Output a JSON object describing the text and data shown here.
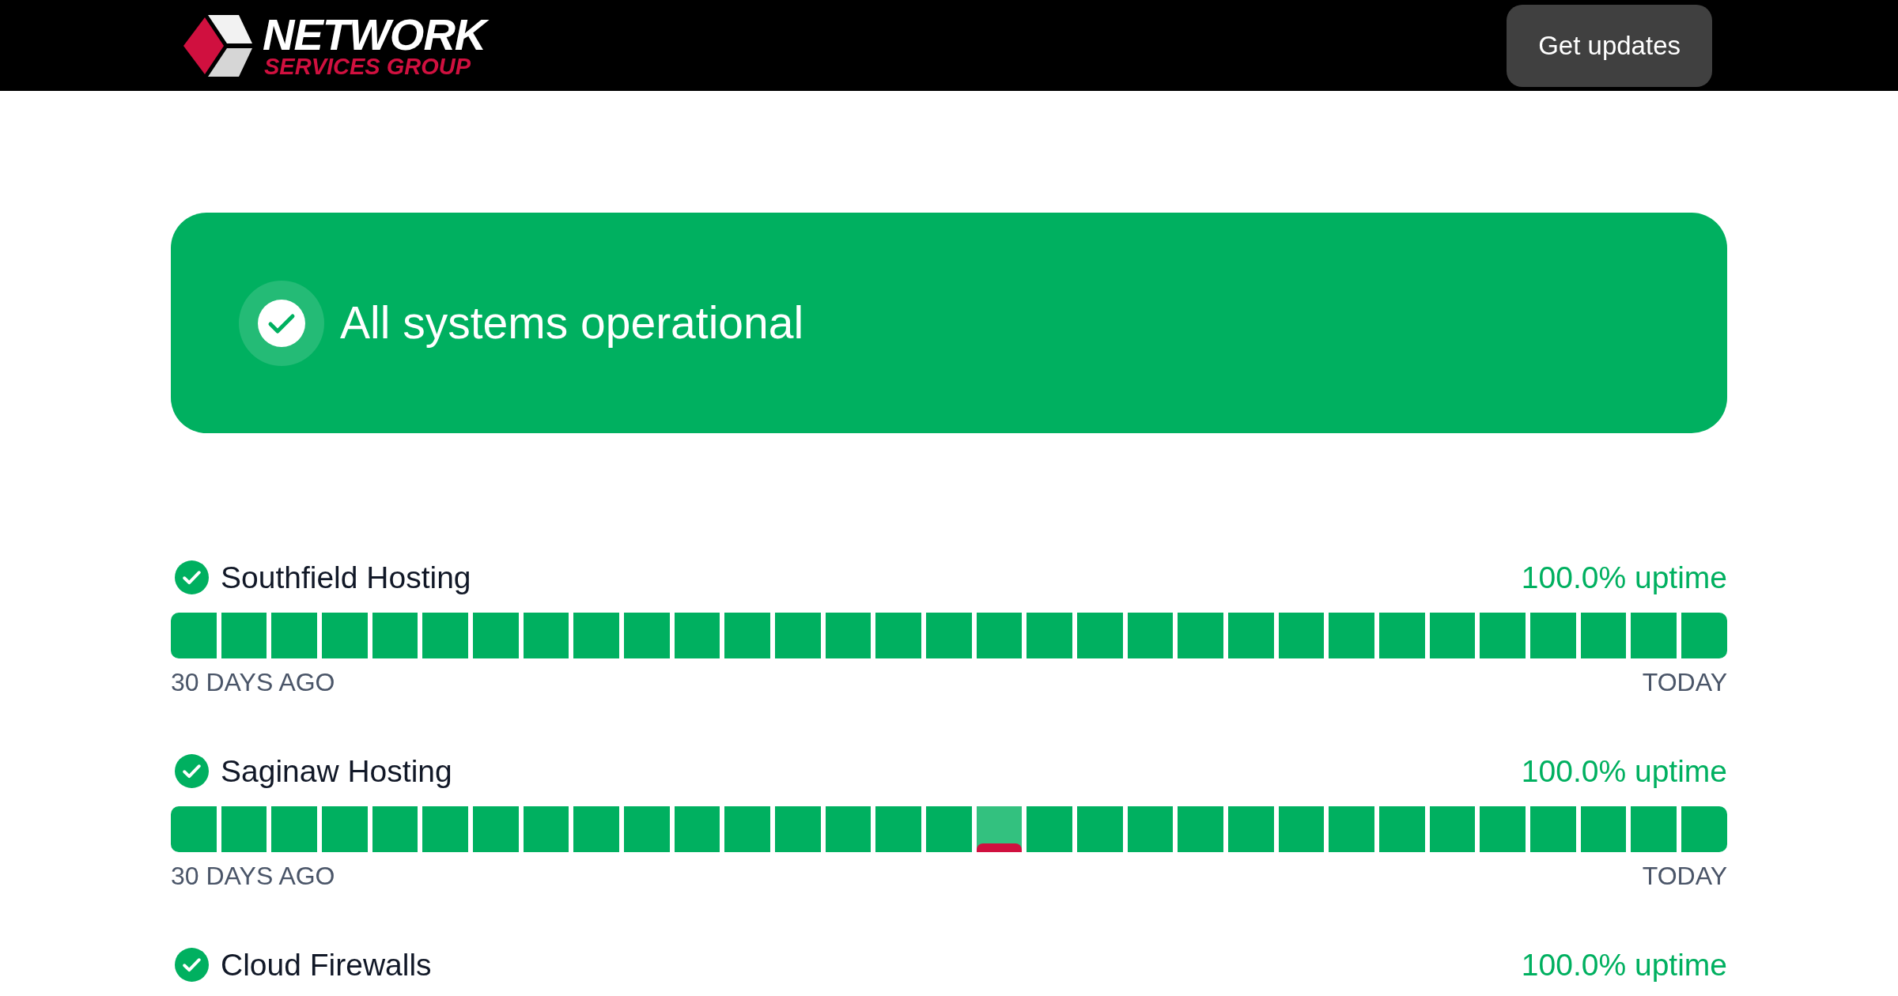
{
  "header": {
    "logo": {
      "name": "NETWORK",
      "tagline": "SERVICES GROUP"
    },
    "button": "Get updates"
  },
  "banner": {
    "operational": true,
    "text": "All systems operational"
  },
  "services": [
    {
      "name": "Southfield Hosting",
      "operational": true,
      "uptime": "100.0% uptime",
      "days": [
        {
          "incident": false
        },
        {
          "incident": false
        },
        {
          "incident": false
        },
        {
          "incident": false
        },
        {
          "incident": false
        },
        {
          "incident": false
        },
        {
          "incident": false
        },
        {
          "incident": false
        },
        {
          "incident": false
        },
        {
          "incident": false
        },
        {
          "incident": false
        },
        {
          "incident": false
        },
        {
          "incident": false
        },
        {
          "incident": false
        },
        {
          "incident": false
        },
        {
          "incident": false
        },
        {
          "incident": false
        },
        {
          "incident": false
        },
        {
          "incident": false
        },
        {
          "incident": false
        },
        {
          "incident": false
        },
        {
          "incident": false
        },
        {
          "incident": false
        },
        {
          "incident": false
        },
        {
          "incident": false
        },
        {
          "incident": false
        },
        {
          "incident": false
        },
        {
          "incident": false
        },
        {
          "incident": false
        },
        {
          "incident": false
        },
        {
          "incident": false
        }
      ],
      "range_start": "30 DAYS AGO",
      "range_end": "TODAY"
    },
    {
      "name": "Saginaw Hosting",
      "operational": true,
      "uptime": "100.0% uptime",
      "days": [
        {
          "incident": false
        },
        {
          "incident": false
        },
        {
          "incident": false
        },
        {
          "incident": false
        },
        {
          "incident": false
        },
        {
          "incident": false
        },
        {
          "incident": false
        },
        {
          "incident": false
        },
        {
          "incident": false
        },
        {
          "incident": false
        },
        {
          "incident": false
        },
        {
          "incident": false
        },
        {
          "incident": false
        },
        {
          "incident": false
        },
        {
          "incident": false
        },
        {
          "incident": false
        },
        {
          "incident": true
        },
        {
          "incident": false
        },
        {
          "incident": false
        },
        {
          "incident": false
        },
        {
          "incident": false
        },
        {
          "incident": false
        },
        {
          "incident": false
        },
        {
          "incident": false
        },
        {
          "incident": false
        },
        {
          "incident": false
        },
        {
          "incident": false
        },
        {
          "incident": false
        },
        {
          "incident": false
        },
        {
          "incident": false
        },
        {
          "incident": false
        }
      ],
      "range_start": "30 DAYS AGO",
      "range_end": "TODAY"
    },
    {
      "name": "Cloud Firewalls",
      "operational": true,
      "uptime": "100.0% uptime"
    }
  ]
}
